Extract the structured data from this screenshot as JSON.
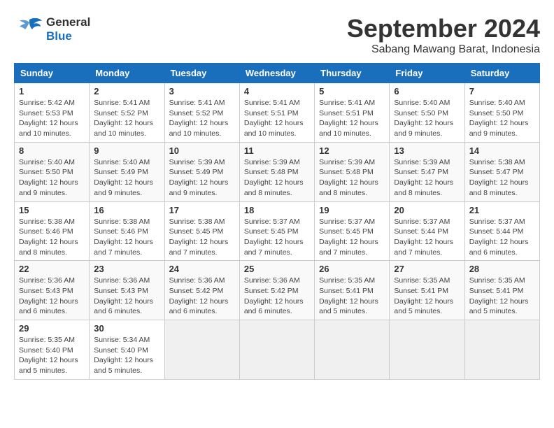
{
  "logo": {
    "line1": "General",
    "line2": "Blue"
  },
  "title": "September 2024",
  "subtitle": "Sabang Mawang Barat, Indonesia",
  "days_of_week": [
    "Sunday",
    "Monday",
    "Tuesday",
    "Wednesday",
    "Thursday",
    "Friday",
    "Saturday"
  ],
  "weeks": [
    [
      {
        "day": "1",
        "info": "Sunrise: 5:42 AM\nSunset: 5:53 PM\nDaylight: 12 hours and 10 minutes."
      },
      {
        "day": "2",
        "info": "Sunrise: 5:41 AM\nSunset: 5:52 PM\nDaylight: 12 hours and 10 minutes."
      },
      {
        "day": "3",
        "info": "Sunrise: 5:41 AM\nSunset: 5:52 PM\nDaylight: 12 hours and 10 minutes."
      },
      {
        "day": "4",
        "info": "Sunrise: 5:41 AM\nSunset: 5:51 PM\nDaylight: 12 hours and 10 minutes."
      },
      {
        "day": "5",
        "info": "Sunrise: 5:41 AM\nSunset: 5:51 PM\nDaylight: 12 hours and 10 minutes."
      },
      {
        "day": "6",
        "info": "Sunrise: 5:40 AM\nSunset: 5:50 PM\nDaylight: 12 hours and 9 minutes."
      },
      {
        "day": "7",
        "info": "Sunrise: 5:40 AM\nSunset: 5:50 PM\nDaylight: 12 hours and 9 minutes."
      }
    ],
    [
      {
        "day": "8",
        "info": "Sunrise: 5:40 AM\nSunset: 5:50 PM\nDaylight: 12 hours and 9 minutes."
      },
      {
        "day": "9",
        "info": "Sunrise: 5:40 AM\nSunset: 5:49 PM\nDaylight: 12 hours and 9 minutes."
      },
      {
        "day": "10",
        "info": "Sunrise: 5:39 AM\nSunset: 5:49 PM\nDaylight: 12 hours and 9 minutes."
      },
      {
        "day": "11",
        "info": "Sunrise: 5:39 AM\nSunset: 5:48 PM\nDaylight: 12 hours and 8 minutes."
      },
      {
        "day": "12",
        "info": "Sunrise: 5:39 AM\nSunset: 5:48 PM\nDaylight: 12 hours and 8 minutes."
      },
      {
        "day": "13",
        "info": "Sunrise: 5:39 AM\nSunset: 5:47 PM\nDaylight: 12 hours and 8 minutes."
      },
      {
        "day": "14",
        "info": "Sunrise: 5:38 AM\nSunset: 5:47 PM\nDaylight: 12 hours and 8 minutes."
      }
    ],
    [
      {
        "day": "15",
        "info": "Sunrise: 5:38 AM\nSunset: 5:46 PM\nDaylight: 12 hours and 8 minutes."
      },
      {
        "day": "16",
        "info": "Sunrise: 5:38 AM\nSunset: 5:46 PM\nDaylight: 12 hours and 7 minutes."
      },
      {
        "day": "17",
        "info": "Sunrise: 5:38 AM\nSunset: 5:45 PM\nDaylight: 12 hours and 7 minutes."
      },
      {
        "day": "18",
        "info": "Sunrise: 5:37 AM\nSunset: 5:45 PM\nDaylight: 12 hours and 7 minutes."
      },
      {
        "day": "19",
        "info": "Sunrise: 5:37 AM\nSunset: 5:45 PM\nDaylight: 12 hours and 7 minutes."
      },
      {
        "day": "20",
        "info": "Sunrise: 5:37 AM\nSunset: 5:44 PM\nDaylight: 12 hours and 7 minutes."
      },
      {
        "day": "21",
        "info": "Sunrise: 5:37 AM\nSunset: 5:44 PM\nDaylight: 12 hours and 6 minutes."
      }
    ],
    [
      {
        "day": "22",
        "info": "Sunrise: 5:36 AM\nSunset: 5:43 PM\nDaylight: 12 hours and 6 minutes."
      },
      {
        "day": "23",
        "info": "Sunrise: 5:36 AM\nSunset: 5:43 PM\nDaylight: 12 hours and 6 minutes."
      },
      {
        "day": "24",
        "info": "Sunrise: 5:36 AM\nSunset: 5:42 PM\nDaylight: 12 hours and 6 minutes."
      },
      {
        "day": "25",
        "info": "Sunrise: 5:36 AM\nSunset: 5:42 PM\nDaylight: 12 hours and 6 minutes."
      },
      {
        "day": "26",
        "info": "Sunrise: 5:35 AM\nSunset: 5:41 PM\nDaylight: 12 hours and 5 minutes."
      },
      {
        "day": "27",
        "info": "Sunrise: 5:35 AM\nSunset: 5:41 PM\nDaylight: 12 hours and 5 minutes."
      },
      {
        "day": "28",
        "info": "Sunrise: 5:35 AM\nSunset: 5:41 PM\nDaylight: 12 hours and 5 minutes."
      }
    ],
    [
      {
        "day": "29",
        "info": "Sunrise: 5:35 AM\nSunset: 5:40 PM\nDaylight: 12 hours and 5 minutes."
      },
      {
        "day": "30",
        "info": "Sunrise: 5:34 AM\nSunset: 5:40 PM\nDaylight: 12 hours and 5 minutes."
      },
      {
        "day": "",
        "info": ""
      },
      {
        "day": "",
        "info": ""
      },
      {
        "day": "",
        "info": ""
      },
      {
        "day": "",
        "info": ""
      },
      {
        "day": "",
        "info": ""
      }
    ]
  ]
}
